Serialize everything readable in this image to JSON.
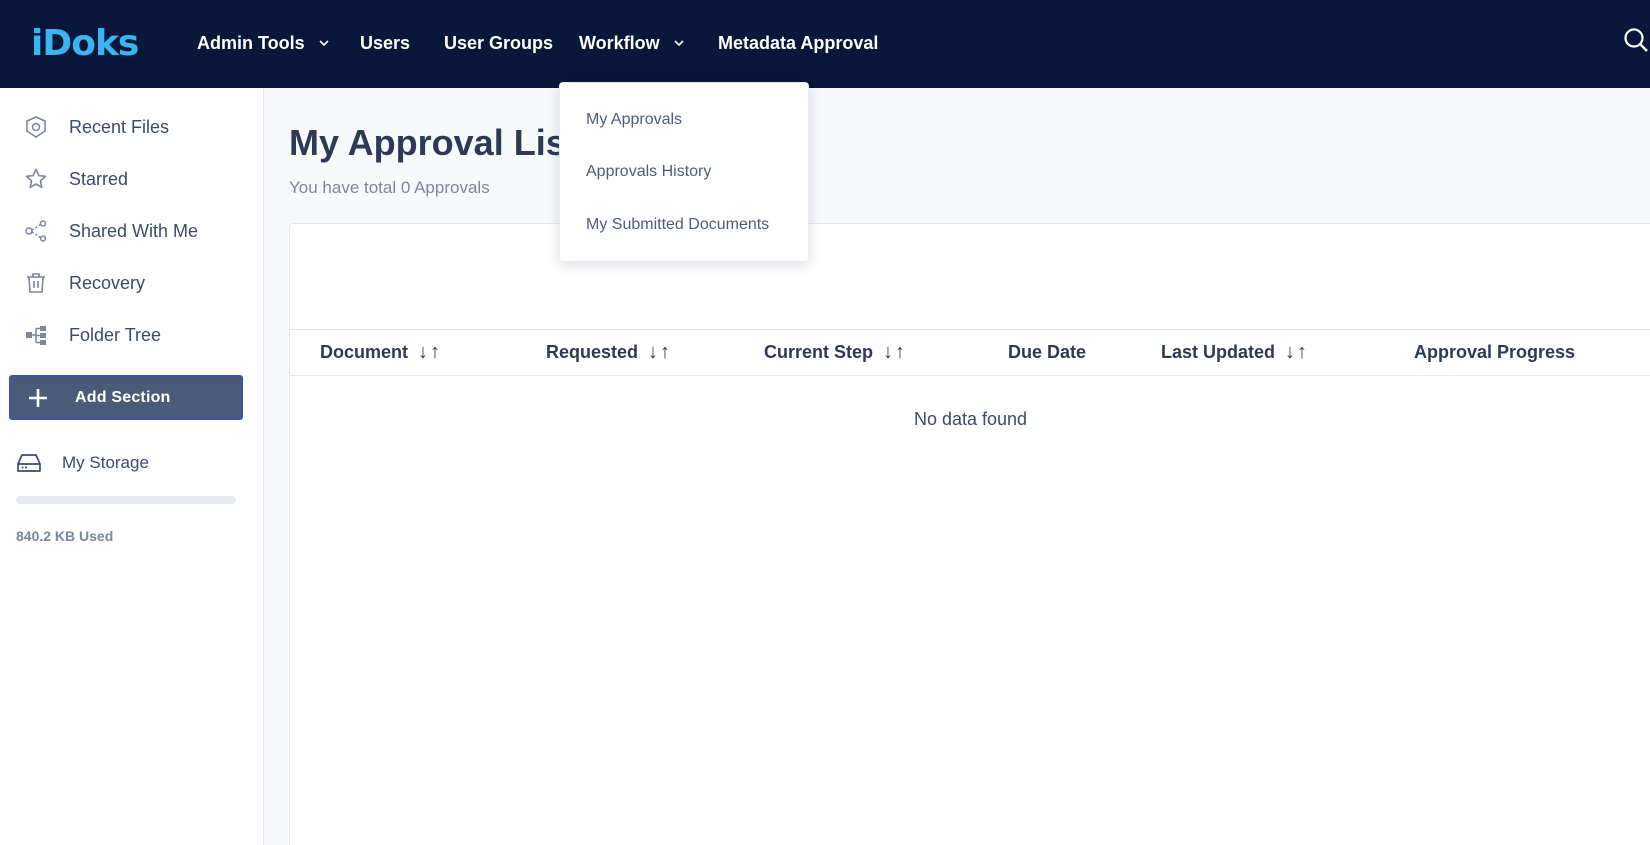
{
  "app": {
    "logo_text": "iDoks",
    "brand_color": "#3bb4f2",
    "topbar_color": "#08173a"
  },
  "nav": {
    "admin_tools": "Admin Tools",
    "users": "Users",
    "user_groups": "User Groups",
    "workflow": "Workflow",
    "metadata_approval": "Metadata Approval"
  },
  "workflow_menu": {
    "items": [
      {
        "label": "My Approvals"
      },
      {
        "label": "Approvals History"
      },
      {
        "label": "My Submitted Documents"
      }
    ]
  },
  "sidebar": {
    "items": [
      {
        "label": "Recent Files",
        "icon": "recent-files-icon"
      },
      {
        "label": "Starred",
        "icon": "star-icon"
      },
      {
        "label": "Shared With Me",
        "icon": "share-icon"
      },
      {
        "label": "Recovery",
        "icon": "trash-icon"
      },
      {
        "label": "Folder Tree",
        "icon": "folder-tree-icon"
      }
    ],
    "add_section_label": "Add Section",
    "storage_label": "My Storage",
    "storage_used": "840.2 KB Used",
    "storage_fraction": 0.0
  },
  "main": {
    "title": "My Approval List",
    "subtitle": "You have total 0 Approvals",
    "columns": [
      {
        "label": "Document",
        "sortable": true
      },
      {
        "label": "Requested",
        "sortable": true
      },
      {
        "label": "Current Step",
        "sortable": true
      },
      {
        "label": "Due Date",
        "sortable": false
      },
      {
        "label": "Last Updated",
        "sortable": true
      },
      {
        "label": "Approval Progress",
        "sortable": false
      }
    ],
    "sort_glyph": "↓↑",
    "empty_message": "No data found"
  }
}
